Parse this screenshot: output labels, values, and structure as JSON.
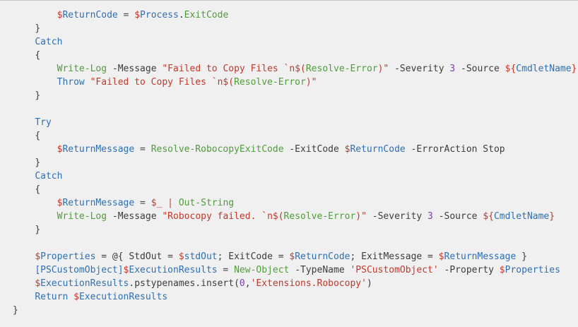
{
  "editor": {
    "language": "PowerShell",
    "colors": {
      "background": "#f0f0f0",
      "default": "#3c3c3c",
      "variable": "#c0392b",
      "variable_name": "#2f6fb3",
      "keyword": "#2f6fb3",
      "function": "#4f9d3a",
      "string": "#c0392b",
      "number": "#7b3fb3",
      "type": "#2f6fb3",
      "operator": "#4a4a4a"
    },
    "lines": [
      {
        "indent": 8,
        "tokens": [
          {
            "t": "$",
            "c": "variable"
          },
          {
            "t": "ReturnCode",
            "c": "variable_name"
          },
          {
            "t": " = ",
            "c": "operator"
          },
          {
            "t": "$",
            "c": "variable"
          },
          {
            "t": "Process",
            "c": "variable_name"
          },
          {
            "t": ".",
            "c": "default"
          },
          {
            "t": "ExitCode",
            "c": "function"
          }
        ]
      },
      {
        "indent": 4,
        "tokens": [
          {
            "t": "}",
            "c": "default"
          }
        ]
      },
      {
        "indent": 4,
        "tokens": [
          {
            "t": "Catch",
            "c": "keyword"
          }
        ]
      },
      {
        "indent": 4,
        "tokens": [
          {
            "t": "{",
            "c": "default"
          }
        ]
      },
      {
        "indent": 8,
        "tokens": [
          {
            "t": "Write-Log",
            "c": "function"
          },
          {
            "t": " -Message ",
            "c": "default"
          },
          {
            "t": "\"Failed to Copy Files `n$(",
            "c": "string"
          },
          {
            "t": "Resolve-Error",
            "c": "function"
          },
          {
            "t": ")\"",
            "c": "string"
          },
          {
            "t": " -Severity ",
            "c": "default"
          },
          {
            "t": "3",
            "c": "number"
          },
          {
            "t": " -Source ",
            "c": "default"
          },
          {
            "t": "${",
            "c": "variable"
          },
          {
            "t": "CmdletName",
            "c": "variable_name"
          },
          {
            "t": "}",
            "c": "variable"
          }
        ]
      },
      {
        "indent": 8,
        "tokens": [
          {
            "t": "Throw",
            "c": "keyword"
          },
          {
            "t": " ",
            "c": "default"
          },
          {
            "t": "\"Failed to Copy Files `n$(",
            "c": "string"
          },
          {
            "t": "Resolve-Error",
            "c": "function"
          },
          {
            "t": ")\"",
            "c": "string"
          }
        ]
      },
      {
        "indent": 4,
        "tokens": [
          {
            "t": "}",
            "c": "default"
          }
        ]
      },
      {
        "indent": 0,
        "tokens": []
      },
      {
        "indent": 4,
        "tokens": [
          {
            "t": "Try",
            "c": "keyword"
          }
        ]
      },
      {
        "indent": 4,
        "tokens": [
          {
            "t": "{",
            "c": "default"
          }
        ]
      },
      {
        "indent": 8,
        "tokens": [
          {
            "t": "$",
            "c": "variable"
          },
          {
            "t": "ReturnMessage",
            "c": "variable_name"
          },
          {
            "t": " = ",
            "c": "operator"
          },
          {
            "t": "Resolve-RobocopyExitCode",
            "c": "function"
          },
          {
            "t": " -ExitCode ",
            "c": "default"
          },
          {
            "t": "$",
            "c": "variable"
          },
          {
            "t": "ReturnCode",
            "c": "variable_name"
          },
          {
            "t": " -ErrorAction Stop",
            "c": "default"
          }
        ]
      },
      {
        "indent": 4,
        "tokens": [
          {
            "t": "}",
            "c": "default"
          }
        ]
      },
      {
        "indent": 4,
        "tokens": [
          {
            "t": "Catch",
            "c": "keyword"
          }
        ]
      },
      {
        "indent": 4,
        "tokens": [
          {
            "t": "{",
            "c": "default"
          }
        ]
      },
      {
        "indent": 8,
        "tokens": [
          {
            "t": "$",
            "c": "variable"
          },
          {
            "t": "ReturnMessage",
            "c": "variable_name"
          },
          {
            "t": " = ",
            "c": "operator"
          },
          {
            "t": "$_",
            "c": "variable"
          },
          {
            "t": " | ",
            "c": "string"
          },
          {
            "t": "Out-String",
            "c": "function"
          }
        ]
      },
      {
        "indent": 8,
        "tokens": [
          {
            "t": "Write-Log",
            "c": "function"
          },
          {
            "t": " -Message ",
            "c": "default"
          },
          {
            "t": "\"Robocopy failed. `n$(",
            "c": "string"
          },
          {
            "t": "Resolve-Error",
            "c": "function"
          },
          {
            "t": ")\"",
            "c": "string"
          },
          {
            "t": " -Severity ",
            "c": "default"
          },
          {
            "t": "3",
            "c": "number"
          },
          {
            "t": " -Source ",
            "c": "default"
          },
          {
            "t": "${",
            "c": "variable"
          },
          {
            "t": "CmdletName",
            "c": "variable_name"
          },
          {
            "t": "}",
            "c": "variable"
          }
        ]
      },
      {
        "indent": 4,
        "tokens": [
          {
            "t": "}",
            "c": "default"
          }
        ]
      },
      {
        "indent": 0,
        "tokens": []
      },
      {
        "indent": 4,
        "tokens": [
          {
            "t": "$",
            "c": "variable"
          },
          {
            "t": "Properties",
            "c": "variable_name"
          },
          {
            "t": " = @{ StdOut = ",
            "c": "default"
          },
          {
            "t": "$",
            "c": "variable"
          },
          {
            "t": "stdOut",
            "c": "variable_name"
          },
          {
            "t": "; ExitCode = ",
            "c": "default"
          },
          {
            "t": "$",
            "c": "variable"
          },
          {
            "t": "ReturnCode",
            "c": "variable_name"
          },
          {
            "t": "; ExitMessage = ",
            "c": "default"
          },
          {
            "t": "$",
            "c": "variable"
          },
          {
            "t": "ReturnMessage",
            "c": "variable_name"
          },
          {
            "t": " }",
            "c": "default"
          }
        ]
      },
      {
        "indent": 4,
        "tokens": [
          {
            "t": "[PSCustomObject]",
            "c": "type"
          },
          {
            "t": "$",
            "c": "variable"
          },
          {
            "t": "ExecutionResults",
            "c": "variable_name"
          },
          {
            "t": " = ",
            "c": "operator"
          },
          {
            "t": "New-Object",
            "c": "function"
          },
          {
            "t": " -TypeName ",
            "c": "default"
          },
          {
            "t": "'PSCustomObject'",
            "c": "string"
          },
          {
            "t": " -Property ",
            "c": "default"
          },
          {
            "t": "$",
            "c": "variable"
          },
          {
            "t": "Properties",
            "c": "variable_name"
          }
        ]
      },
      {
        "indent": 4,
        "tokens": [
          {
            "t": "$",
            "c": "variable"
          },
          {
            "t": "ExecutionResults",
            "c": "variable_name"
          },
          {
            "t": ".pstypenames.insert(",
            "c": "default"
          },
          {
            "t": "0",
            "c": "number"
          },
          {
            "t": ",",
            "c": "default"
          },
          {
            "t": "'Extensions.Robocopy'",
            "c": "string"
          },
          {
            "t": ")",
            "c": "default"
          }
        ]
      },
      {
        "indent": 4,
        "tokens": [
          {
            "t": "Return",
            "c": "keyword"
          },
          {
            "t": " ",
            "c": "default"
          },
          {
            "t": "$",
            "c": "variable"
          },
          {
            "t": "ExecutionResults",
            "c": "variable_name"
          }
        ]
      },
      {
        "indent": 0,
        "tokens": [
          {
            "t": "}",
            "c": "default"
          }
        ]
      }
    ]
  }
}
